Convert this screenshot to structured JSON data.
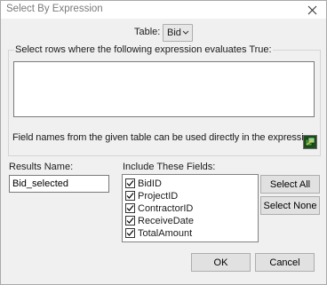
{
  "window": {
    "title": "Select By Expression",
    "close_icon": "close-icon"
  },
  "table": {
    "label": "Table:",
    "selected": "Bid"
  },
  "expression": {
    "group_label": "Select rows where the following expression evaluates True:",
    "value": "",
    "hint": "Field names from the given table can be used directly in the expression.",
    "builder_icon": "expression-builder-icon"
  },
  "results": {
    "label": "Results Name:",
    "value": "Bid_selected"
  },
  "fields": {
    "label": "Include These Fields:",
    "items": [
      {
        "label": "BidID",
        "checked": true
      },
      {
        "label": "ProjectID",
        "checked": true
      },
      {
        "label": "ContractorID",
        "checked": true
      },
      {
        "label": "ReceiveDate",
        "checked": true
      },
      {
        "label": "TotalAmount",
        "checked": true
      }
    ]
  },
  "buttons": {
    "select_all": "Select All",
    "select_none": "Select None",
    "ok": "OK",
    "cancel": "Cancel"
  }
}
